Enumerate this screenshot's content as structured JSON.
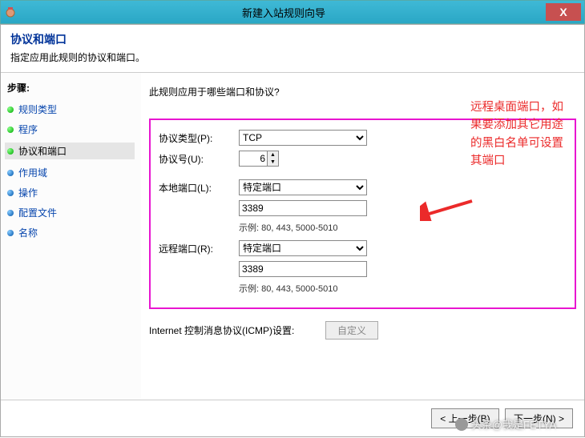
{
  "titlebar": {
    "title": "新建入站规则向导",
    "close": "X"
  },
  "header": {
    "title": "协议和端口",
    "desc": "指定应用此规则的协议和端口。"
  },
  "steps": {
    "heading": "步骤:",
    "items": [
      {
        "label": "规则类型",
        "active": false
      },
      {
        "label": "程序",
        "active": false
      },
      {
        "label": "协议和端口",
        "active": true
      },
      {
        "label": "作用域",
        "active": false
      },
      {
        "label": "操作",
        "active": false
      },
      {
        "label": "配置文件",
        "active": false
      },
      {
        "label": "名称",
        "active": false
      }
    ]
  },
  "content": {
    "question": "此规则应用于哪些端口和协议?",
    "protocol_type_label": "协议类型(P):",
    "protocol_type_value": "TCP",
    "protocol_number_label": "协议号(U):",
    "protocol_number_value": "6",
    "local_port_label": "本地端口(L):",
    "local_port_select": "特定端口",
    "local_port_value": "3389",
    "local_port_example": "示例: 80, 443, 5000-5010",
    "remote_port_label": "远程端口(R):",
    "remote_port_select": "特定端口",
    "remote_port_value": "3389",
    "remote_port_example": "示例: 80, 443, 5000-5010",
    "icmp_label": "Internet 控制消息协议(ICMP)设置:",
    "icmp_button": "自定义"
  },
  "annotation": {
    "text": "远程桌面端口，如果要添加其它用途的黑白名单可设置其端口"
  },
  "footer": {
    "back": "< 上一步(B)",
    "next": "下一步(N) >"
  },
  "watermark": {
    "text": "头条@我是FETYA"
  }
}
